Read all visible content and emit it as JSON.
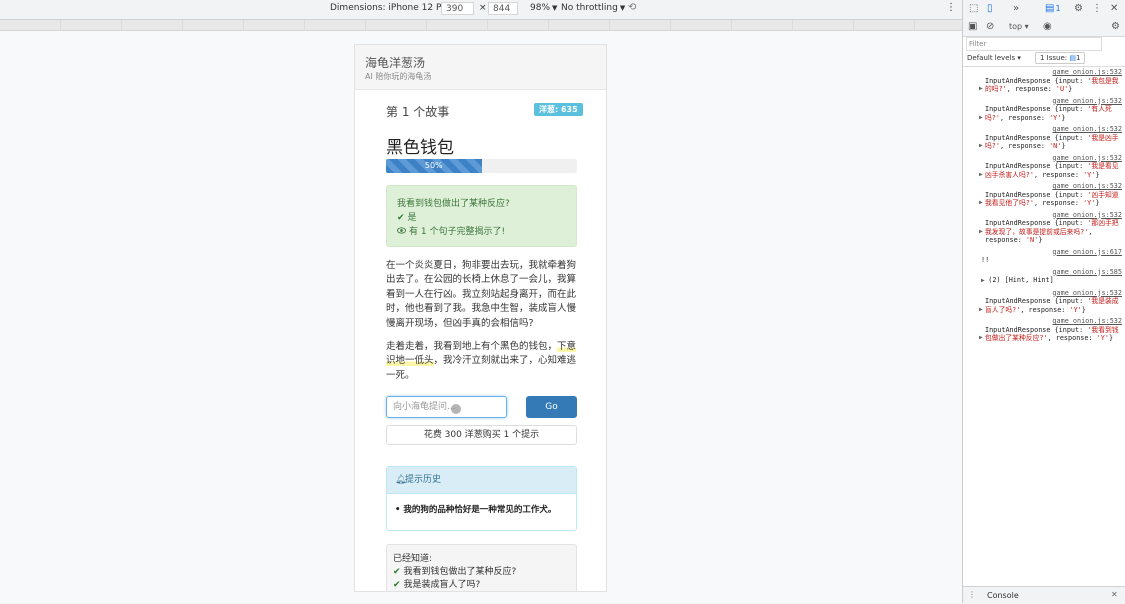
{
  "device_toolbar": {
    "dimensions_label": "Dimensions: iPhone 12 Pro",
    "width": "390",
    "times": "×",
    "height": "844",
    "zoom": "98%",
    "throttling": "No throttling"
  },
  "app": {
    "title": "海龟洋葱汤",
    "subtitle": "AI 陪你玩的海龟汤"
  },
  "story": {
    "header": "第 1 个故事",
    "badge": "洋葱: 635",
    "puzzle_name": "黑色钱包",
    "progress_percent": 50,
    "progress_label": "50%",
    "answer": {
      "question": "我看到钱包做出了某种反应?",
      "result": "是",
      "reveal": "有 1 个句子完整揭示了!"
    },
    "paragraph1": "在一个炎炎夏日，狗非要出去玩，我就牵着狗出去了。在公园的长椅上休息了一会儿，我算看到一人在行凶。我立刻站起身离开，而在此时，他也看到了我。我急中生智，装成盲人慢慢离开现场，但凶手真的会相信吗?",
    "paragraph2_pre": "走着走着，我看到地上有个黑色的钱包，",
    "paragraph2_hl": "下意识地一低头",
    "paragraph2_post": "，我冷汗立刻就出来了，心知难逃一死。"
  },
  "controls": {
    "input_placeholder": "向小海龟提问...",
    "go_label": "Go",
    "buy_hint_label": "花费 300 洋葱购买 1 个提示"
  },
  "hints": {
    "title": "提示历史",
    "items": [
      "我的狗的品种恰好是一种常见的工作犬。"
    ]
  },
  "known": {
    "title": "已经知道:",
    "items": [
      "我看到钱包做出了某种反应?",
      "我是装成盲人了吗?"
    ]
  },
  "devtools": {
    "top_label": "top",
    "filter_placeholder": "Filter",
    "default_levels": "Default levels",
    "issue_label": "1 Issue:",
    "issue_count": "1",
    "messages_count": "1",
    "drawer_label": "Console",
    "logs": [
      {
        "src": "game_onion.js:532",
        "prefix": "InputAndResponse {input: ",
        "input": "'我包是我的吗?'",
        "mid": ", response: ",
        "response": "'U'",
        "suffix": "}"
      },
      {
        "src": "game_onion.js:532",
        "prefix": "InputAndResponse {input: ",
        "input": "'有人死吗?'",
        "mid": ", response: ",
        "response": "'Y'",
        "suffix": "}"
      },
      {
        "src": "game_onion.js:532",
        "prefix": "InputAndResponse {input: ",
        "input": "'我是凶手吗?'",
        "mid": ", response: ",
        "response": "'N'",
        "suffix": "}"
      },
      {
        "src": "game_onion.js:532",
        "prefix": "InputAndResponse {input: ",
        "input": "'我是看见凶手杀害人吗?'",
        "mid": ", response: ",
        "response": "'Y'",
        "suffix": "}"
      },
      {
        "src": "game_onion.js:532",
        "prefix": "InputAndResponse {input: ",
        "input": "'凶手知道我看见他了吗?'",
        "mid": ", response: ",
        "response": "'Y'",
        "suffix": "}"
      },
      {
        "src": "game_onion.js:532",
        "prefix": "InputAndResponse {input: ",
        "input": "'那凶手把我发现了，故事是提前或后来吗?'",
        "mid": ", response: ",
        "response": "'N'",
        "suffix": "}"
      }
    ],
    "misc1_src": "game_onion.js:617",
    "misc1_text": "!!",
    "misc2_src": "game_onion.js:585",
    "misc2_text": "(2) [Hint, Hint]",
    "logs2": [
      {
        "src": "game_onion.js:532",
        "prefix": "InputAndResponse {input: ",
        "input": "'我是装成盲人了吗?'",
        "mid": ", response: ",
        "response": "'Y'",
        "suffix": "}"
      },
      {
        "src": "game_onion.js:532",
        "prefix": "InputAndResponse {input: ",
        "input": "'我看到钱包做出了某种反应?'",
        "mid": ", response: ",
        "response": "'Y'",
        "suffix": "}"
      }
    ]
  }
}
